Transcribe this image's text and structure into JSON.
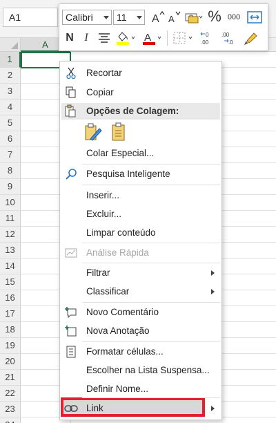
{
  "namebox": {
    "value": "A1"
  },
  "sheet": {
    "column_header": "A",
    "rows": [
      "1",
      "2",
      "3",
      "4",
      "5",
      "6",
      "7",
      "8",
      "9",
      "10",
      "11",
      "12",
      "13",
      "14",
      "15",
      "16",
      "17",
      "18",
      "19",
      "20",
      "21",
      "22",
      "23",
      "24"
    ]
  },
  "mini_toolbar": {
    "font_name": "Calibri",
    "font_size": "11",
    "bold": "N",
    "italic": "I",
    "percent": "%",
    "thousands": "000",
    "colors": {
      "highlight": "#ffff00",
      "font": "#e00000"
    }
  },
  "menu": {
    "items": [
      {
        "id": "cut",
        "label": "Recortar",
        "icon": "scissors-icon"
      },
      {
        "id": "copy",
        "label": "Copiar",
        "icon": "copy-icon"
      },
      {
        "id": "paste_header",
        "label": "Opções de Colagem:",
        "icon": "paste-icon"
      },
      {
        "id": "paste_special",
        "label": "Colar Especial..."
      },
      {
        "id": "smart_lookup",
        "label": "Pesquisa Inteligente",
        "icon": "search-icon"
      },
      {
        "id": "insert",
        "label": "Inserir..."
      },
      {
        "id": "delete",
        "label": "Excluir..."
      },
      {
        "id": "clear",
        "label": "Limpar conteúdo"
      },
      {
        "id": "quick_analysis",
        "label": "Análise Rápida",
        "icon": "quick-analysis-icon",
        "disabled": true
      },
      {
        "id": "filter",
        "label": "Filtrar",
        "submenu": true
      },
      {
        "id": "sort",
        "label": "Classificar",
        "submenu": true
      },
      {
        "id": "new_comment",
        "label": "Novo Comentário",
        "icon": "new-comment-icon"
      },
      {
        "id": "new_note",
        "label": "Nova Anotação",
        "icon": "new-note-icon"
      },
      {
        "id": "format_cells",
        "label": "Formatar células...",
        "icon": "format-cells-icon"
      },
      {
        "id": "pick_list",
        "label": "Escolher na Lista Suspensa..."
      },
      {
        "id": "define_name",
        "label": "Definir Nome..."
      },
      {
        "id": "link",
        "label": "Link",
        "icon": "link-icon",
        "submenu": true,
        "highlighted": true
      }
    ]
  },
  "highlight_color": "#e5202e",
  "accent_color": "#217346"
}
